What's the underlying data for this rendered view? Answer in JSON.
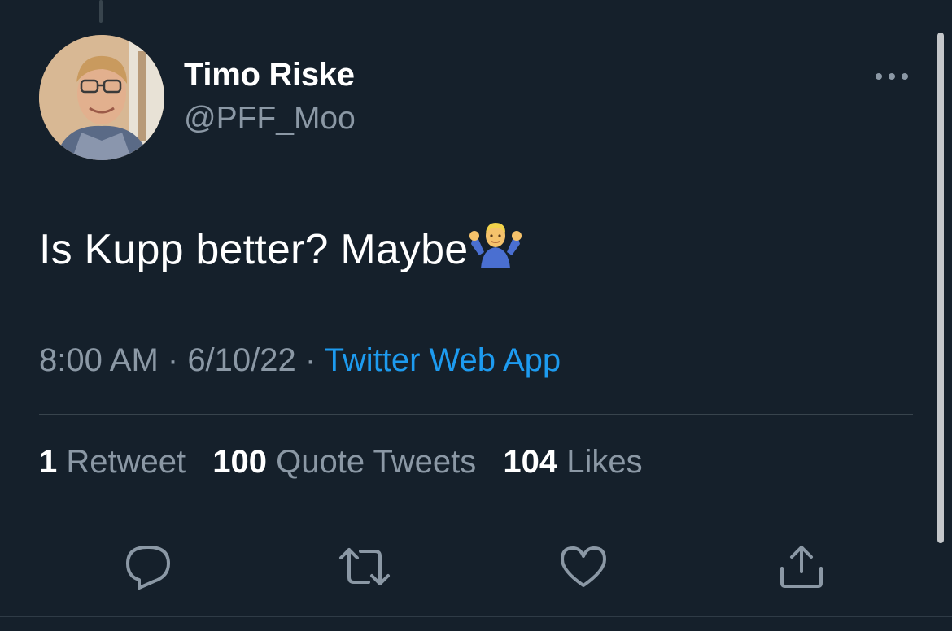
{
  "tweet": {
    "author": {
      "name": "Timo Riske",
      "handle": "@PFF_Moo"
    },
    "text": "Is Kupp better? Maybe",
    "emoji": "man-shrugging-emoji",
    "time": "8:00 AM",
    "date": "6/10/22",
    "separator": " · ",
    "source": "Twitter Web App",
    "stats": {
      "retweets": "1",
      "retweets_label": "Retweet",
      "quotes": "100",
      "quotes_label": "Quote Tweets",
      "likes": "104",
      "likes_label": "Likes"
    }
  },
  "icons": {
    "more": "more-dots-icon",
    "reply": "reply-icon",
    "retweet": "retweet-icon",
    "like": "heart-icon",
    "share": "share-icon"
  },
  "colors": {
    "background": "#15202b",
    "text_primary": "#ffffff",
    "text_secondary": "#8b98a5",
    "link": "#1d9bf0",
    "divider": "#38444d"
  }
}
